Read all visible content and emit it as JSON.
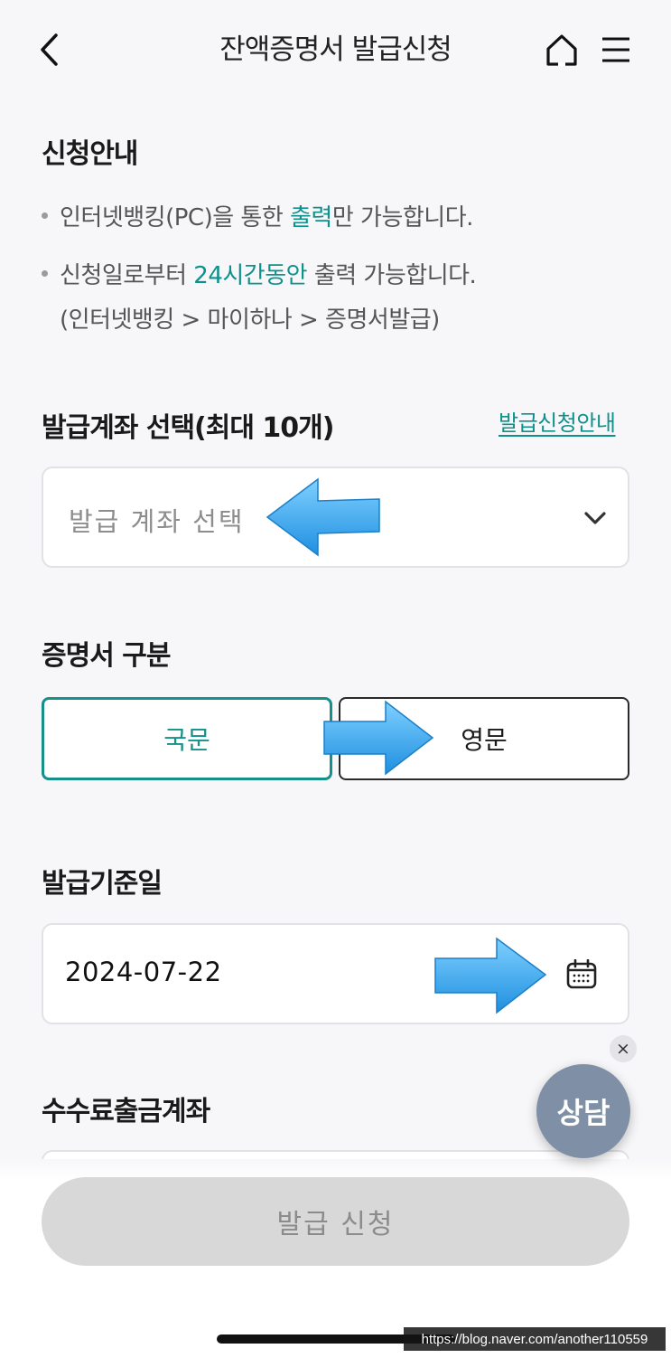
{
  "header": {
    "title": "잔액증명서 발급신청",
    "icons": {
      "back": "back-icon",
      "home": "home-icon",
      "menu": "menu-icon"
    }
  },
  "notice": {
    "title": "신청안내",
    "bullet1": {
      "pre": "인터넷뱅킹(PC)을 통한 ",
      "highlight": "출력",
      "post": "만 가능합니다."
    },
    "bullet2": {
      "pre": "신청일로부터 ",
      "highlight": "24시간동안",
      "post": " 출력 가능합니다.",
      "line2": "(인터넷뱅킹 > 마이하나 > 증명서발급)"
    }
  },
  "account_select": {
    "title": "발급계좌 선택(최대 10개)",
    "guide_link": "발급신청안내",
    "placeholder": "발급 계좌 선택"
  },
  "cert_type": {
    "title": "증명서 구분",
    "options": [
      "국문",
      "영문"
    ],
    "selected": "국문"
  },
  "base_date": {
    "title": "발급기준일",
    "value": "2024-07-22"
  },
  "fee_account": {
    "title": "수수료출금계좌"
  },
  "chat": {
    "label": "상담",
    "close": "×"
  },
  "submit": {
    "label": "발급 신청"
  },
  "watermark": "https://blog.naver.com/another110559",
  "colors": {
    "accent": "#0e918c",
    "arrow": "#2aa6f0",
    "chat_bg": "#7f8fa6",
    "submit_bg": "#d8d8d8"
  }
}
